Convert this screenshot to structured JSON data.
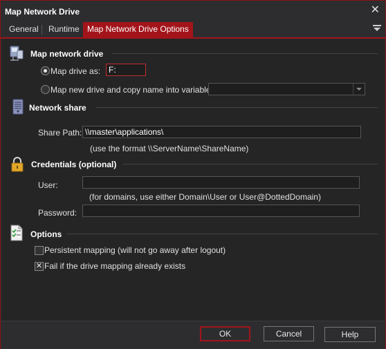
{
  "window": {
    "title": "Map Network Drive",
    "close_glyph": "✕"
  },
  "tabs": [
    {
      "label": "General"
    },
    {
      "label": "Runtime"
    },
    {
      "label": "Map Network Drive Options",
      "active": true
    }
  ],
  "sections": {
    "map_drive": {
      "title": "Map network drive",
      "icon": "network-drive-icon",
      "radio_map_as": {
        "label": "Map drive as:",
        "checked": true,
        "value": "F:"
      },
      "radio_new_drive": {
        "label": "Map new drive and copy name into variable:",
        "checked": false,
        "value": ""
      }
    },
    "network_share": {
      "title": "Network share",
      "icon": "server-icon",
      "share_path_label": "Share Path:",
      "share_path_value": "\\\\master\\applications\\",
      "share_path_hint": "(use the format \\\\ServerName\\ShareName)"
    },
    "credentials": {
      "title": "Credentials (optional)",
      "icon": "lock-icon",
      "user_label": "User:",
      "user_value": "",
      "user_hint": "(for domains, use either Domain\\User or User@DottedDomain)",
      "password_label": "Password:",
      "password_value": ""
    },
    "options": {
      "title": "Options",
      "icon": "checklist-icon",
      "persistent": {
        "label": "Persistent mapping (will not go away after logout)",
        "checked": false
      },
      "fail_if_exists": {
        "label": "Fail if the drive mapping already exists",
        "checked": true
      }
    }
  },
  "buttons": {
    "ok": "OK",
    "cancel": "Cancel",
    "help": "Help"
  },
  "colors": {
    "accent": "#a3141a",
    "background": "#2d2d30",
    "panel": "#252526"
  }
}
